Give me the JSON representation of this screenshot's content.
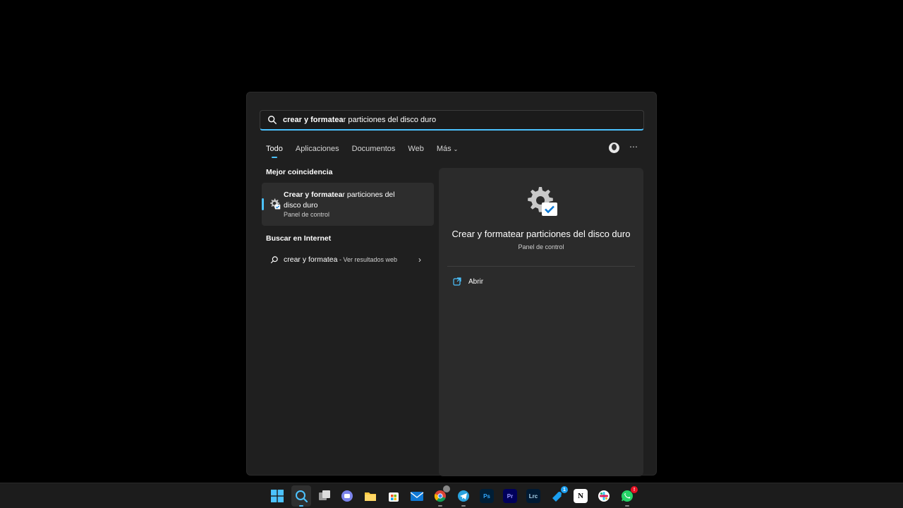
{
  "search": {
    "query_bold": "crear y formatea",
    "query_rest": "r particiones del disco duro",
    "placeholder": "",
    "accent": "#4cc2ff"
  },
  "tabs": [
    {
      "label": "Todo",
      "active": true
    },
    {
      "label": "Aplicaciones",
      "active": false
    },
    {
      "label": "Documentos",
      "active": false
    },
    {
      "label": "Web",
      "active": false
    },
    {
      "label": "Más",
      "active": false
    }
  ],
  "header_icons": {
    "avatar": "user-avatar",
    "more": "⋯"
  },
  "best_match": {
    "heading": "Mejor coincidencia",
    "title_bold": "Crear y formatea",
    "title_rest": "r particiones del disco duro",
    "subtitle": "Panel de control",
    "icon": "gear-check-icon"
  },
  "internet": {
    "heading": "Buscar en Internet",
    "query": "crear y formatea",
    "suffix": " - Ver resultados web",
    "icon": "search-icon"
  },
  "detail": {
    "title": "Crear y formatear particiones del disco duro",
    "subtitle": "Panel de control",
    "action_open": "Abrir"
  },
  "taskbar": {
    "icons": [
      {
        "name": "windows-start-icon",
        "color": "#4cc2ff"
      },
      {
        "name": "search-icon",
        "color": "#4cc2ff"
      },
      {
        "name": "task-view-icon",
        "color": "#cccccc"
      },
      {
        "name": "teams-chat-icon",
        "color": "#7b83eb"
      },
      {
        "name": "file-explorer-icon",
        "color": "#ffc83d"
      },
      {
        "name": "microsoft-store-icon",
        "color": "#ffffff"
      },
      {
        "name": "mail-icon",
        "color": "#0f78d4"
      },
      {
        "name": "chrome-icon",
        "color": "#4caf50"
      },
      {
        "name": "telegram-icon",
        "color": "#2aa3df"
      },
      {
        "name": "photoshop-icon",
        "color": "#31a8ff"
      },
      {
        "name": "premiere-icon",
        "color": "#9999ff"
      },
      {
        "name": "lightroom-classic-icon",
        "color": "#add5ec"
      },
      {
        "name": "steam-icon",
        "color": "#1b9ff0"
      },
      {
        "name": "notion-icon",
        "color": "#ffffff"
      },
      {
        "name": "slack-icon",
        "color": "#e01e5a"
      },
      {
        "name": "whatsapp-icon",
        "color": "#25d366"
      }
    ],
    "labels": {
      "ps": "Ps",
      "pr": "Pr",
      "lrc": "Lrc",
      "notion": "N"
    },
    "badges": {
      "steam": "1",
      "whatsapp": "!"
    }
  }
}
